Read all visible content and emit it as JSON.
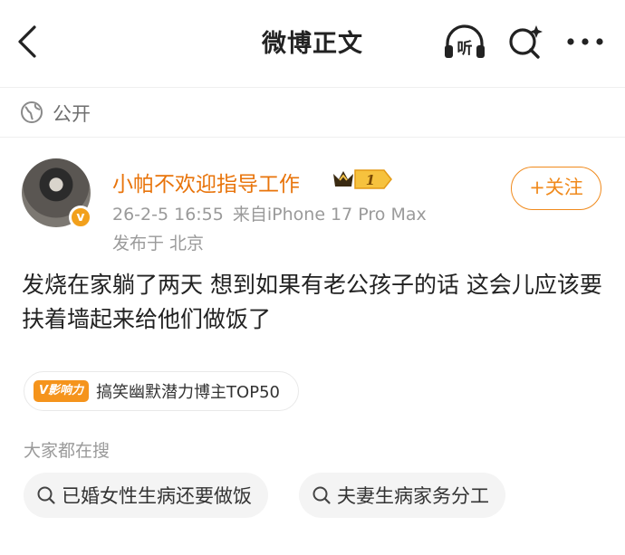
{
  "header": {
    "title": "微博正文",
    "listen_icon_text": "听"
  },
  "visibility": {
    "label": "公开"
  },
  "post": {
    "username": "小帕不欢迎指导工作",
    "vip_level": "1",
    "time": "26-2-5 16:55",
    "source": "来自iPhone 17 Pro Max",
    "location": "发布于 北京",
    "follow_label": "+关注",
    "content": "发烧在家躺了两天 想到如果有老公孩子的话 这会儿应该要扶着墙起来给他们做饭了",
    "verified_badge": "v"
  },
  "influence": {
    "badge": "V影响力",
    "text": "搞笑幽默潜力博主TOP50"
  },
  "search": {
    "heading": "大家都在搜",
    "chips": [
      "已婚女性生病还要做饭",
      "夫妻生病家务分工"
    ]
  },
  "colors": {
    "accent": "#f08a1c",
    "username": "#e8740b"
  }
}
